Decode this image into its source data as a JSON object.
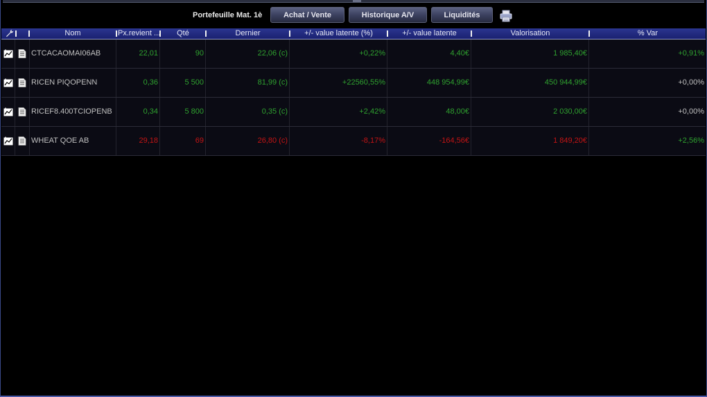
{
  "toolbar": {
    "portfolio_title": "Portefeuille Mat. 1è",
    "buttons": {
      "trade": "Achat / Vente",
      "history": "Historique A/V",
      "cash": "Liquidités"
    },
    "print_icon": "printer-icon"
  },
  "table": {
    "settings_icon": "wrench-icon",
    "columns": {
      "name": "Nom",
      "cost_price": "Px.revient ...",
      "quantity": "Qté",
      "last": "Dernier",
      "unrealized_pct": "+/- value latente (%)",
      "unrealized": "+/- value latente",
      "valuation": "Valorisation",
      "change_pct": "% Var"
    },
    "row_icons": [
      "chart-add-icon",
      "document-icon"
    ],
    "rows": [
      {
        "name": "CTCACAOMAI06AB",
        "cost_price": "22,01",
        "quantity": "90",
        "last": "22,06 (c)",
        "unrealized_pct": "+0,22%",
        "unrealized": "4,40€",
        "valuation": "1 985,40€",
        "change_pct": "+0,91%",
        "tone": "green",
        "change_tone": "green"
      },
      {
        "name": "RICEN PIQOPENN",
        "cost_price": "0,36",
        "quantity": "5 500",
        "last": "81,99 (c)",
        "unrealized_pct": "+22560,55%",
        "unrealized": "448 954,99€",
        "valuation": "450 944,99€",
        "change_pct": "+0,00%",
        "tone": "green",
        "change_tone": "grey"
      },
      {
        "name": "RICEF8.400TCIOPENB",
        "cost_price": "0,34",
        "quantity": "5 800",
        "last": "0,35 (c)",
        "unrealized_pct": "+2,42%",
        "unrealized": "48,00€",
        "valuation": "2 030,00€",
        "change_pct": "+0,00%",
        "tone": "green",
        "change_tone": "grey"
      },
      {
        "name": "WHEAT QOE AB",
        "cost_price": "29,18",
        "quantity": "69",
        "last": "26,80 (c)",
        "unrealized_pct": "-8,17%",
        "unrealized": "-164,56€",
        "valuation": "1 849,20€",
        "change_pct": "+2,56%",
        "tone": "red",
        "change_tone": "green"
      }
    ]
  },
  "colors": {
    "positive": "#2fa12f",
    "negative": "#c41414",
    "neutral": "#c0c0c0",
    "header_bg": "#2b3590"
  }
}
